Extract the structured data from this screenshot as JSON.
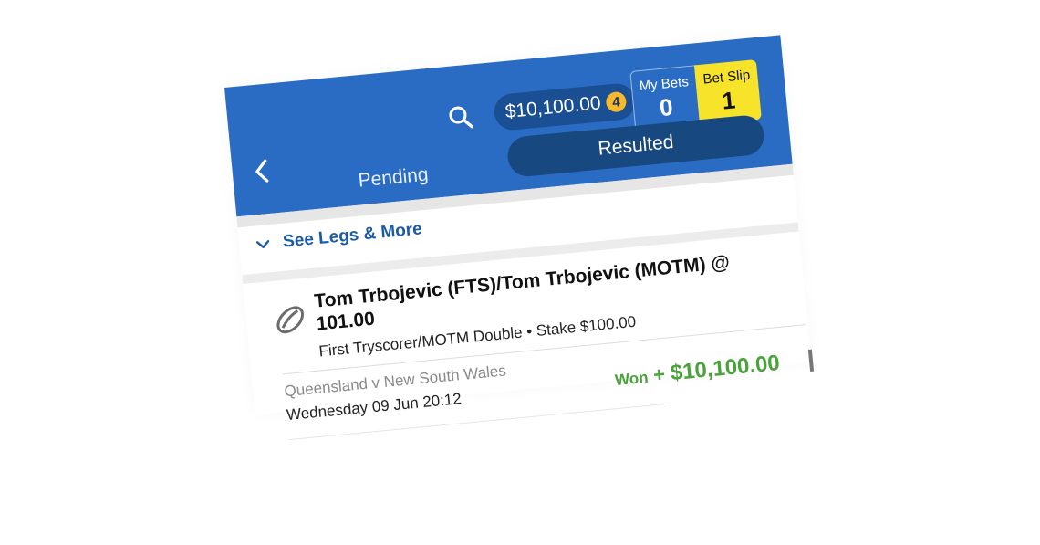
{
  "header": {
    "balance": "$10,100.00",
    "balance_badge": "4",
    "my_bets": {
      "label": "My Bets",
      "count": "0"
    },
    "bet_slip": {
      "label": "Bet Slip",
      "count": "1"
    }
  },
  "tabs": [
    {
      "label": "Pending",
      "active": false
    },
    {
      "label": "Resulted",
      "active": true
    }
  ],
  "bet": {
    "legs_toggle_label": "See Legs & More",
    "title": "Tom Trbojevic (FTS)/Tom Trbojevic (MOTM) @ 101.00",
    "description": "First Tryscorer/MOTM Double • Stake $100.00",
    "event": "Queensland v New South Wales",
    "time": "Wednesday 09 Jun 20:12",
    "result_label": "Won",
    "result_sign": "+",
    "result_amount": "$10,100.00"
  },
  "icons": {
    "back": "chevron-left-icon",
    "search": "search-icon",
    "legs": "chevron-down-icon",
    "sport": "rugby-ball-icon"
  },
  "colors": {
    "header_blue": "#2a6cc3",
    "active_tab": "#17487f",
    "bet_slip_yellow": "#f7e32a",
    "badge_gold": "#f5b82e",
    "link_blue": "#1b5aa8",
    "win_green": "#4aa33a"
  }
}
